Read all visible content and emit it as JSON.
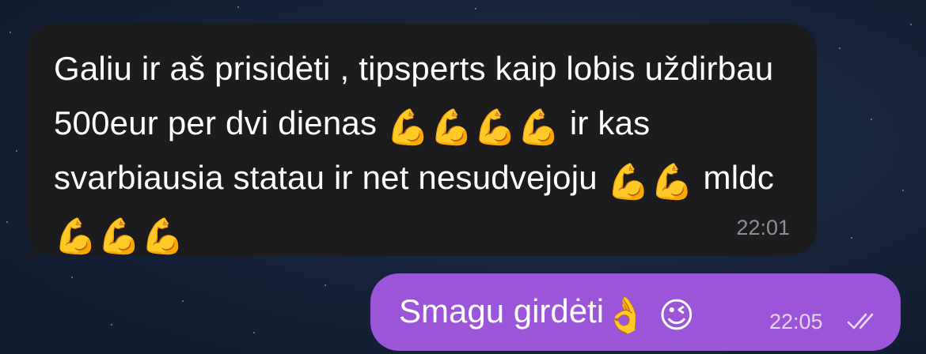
{
  "messages": [
    {
      "direction": "incoming",
      "text_parts": [
        "Galiu ir aš prisidėti , tipsperts kaip lobis uždirbau 500eur per dvi dienas ",
        " ir kas svarbiausia statau ir net nesudvejoju ",
        " mldc "
      ],
      "emoji_groups": [
        "💪💪💪💪",
        "💪💪",
        "💪💪💪"
      ],
      "time": "22:01",
      "bubble_color": "#1c1c1e"
    },
    {
      "direction": "outgoing",
      "text": "Smagu girdėti",
      "emoji": "👌 😉",
      "time": "22:05",
      "status_icon": "double-check-icon",
      "bubble_color": "#9a55d8"
    }
  ],
  "background": {
    "colors": [
      "#1f3050",
      "#17233b",
      "#101a2d"
    ],
    "style": "starry-night"
  }
}
